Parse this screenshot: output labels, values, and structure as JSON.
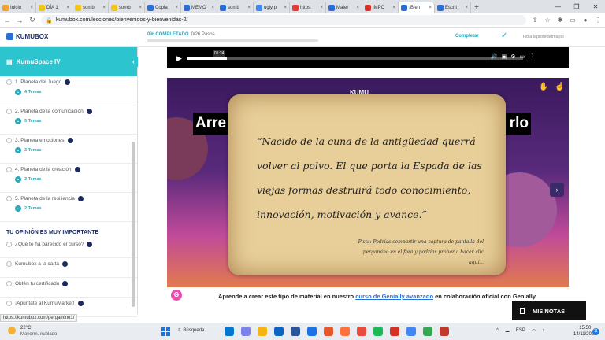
{
  "browser": {
    "tabs": [
      {
        "label": "Inicio",
        "color": "#f0a22b"
      },
      {
        "label": "DÍA 1",
        "color": "#f0c419"
      },
      {
        "label": "somb",
        "color": "#f0c419"
      },
      {
        "label": "somb",
        "color": "#f0c419"
      },
      {
        "label": "Copia",
        "color": "#2b6fd6"
      },
      {
        "label": "MEMO",
        "color": "#2b6fd6"
      },
      {
        "label": "somb",
        "color": "#2b6fd6"
      },
      {
        "label": "ugly p",
        "color": "#4285f4"
      },
      {
        "label": "https:",
        "color": "#e53935"
      },
      {
        "label": "Mater",
        "color": "#2b6fd6"
      },
      {
        "label": "IMPO",
        "color": "#d93025"
      },
      {
        "label": "¡Bien",
        "color": "#2b6fd6",
        "active": true
      },
      {
        "label": "Escrit",
        "color": "#2b6fd6"
      }
    ],
    "url": "kumubox.com/lecciones/bienvenidos-y-bienvenidas-2/",
    "status_url": "https://kumubox.com/pergamino1/"
  },
  "header": {
    "logo": "KUMUBOX",
    "progress_label": "0% COMPLETADO",
    "progress_steps": "0/26 Pasos",
    "progress_value": 0,
    "complete_label": "Completar",
    "greeting": "Hola laprofedelmapsi"
  },
  "sidebar": {
    "title": "KumuSpace IV",
    "items": [
      {
        "label": "1. Planeta del Juego",
        "sub": "4 Temas"
      },
      {
        "label": "2. Planeta de la comunicación",
        "sub": "3 Temas"
      },
      {
        "label": "3. Planeta emociones",
        "sub": "3 Temas"
      },
      {
        "label": "4. Planeta de la creación",
        "sub": "3 Temas"
      },
      {
        "label": "5. Planeta de la resiliencia",
        "sub": "2 Temas"
      }
    ],
    "section_title": "TU OPINIÓN ES MUY IMPORTANTE",
    "opinion_items": [
      {
        "label": "¿Qué te ha parecido el curso?"
      },
      {
        "label": "Kumubox a la carta"
      },
      {
        "label": "Obtén tu certificado"
      },
      {
        "label": "¡Apúntate al KumuMarket!"
      }
    ]
  },
  "video": {
    "time": "01:24",
    "progress": 0.12
  },
  "genially": {
    "kumu_tag": "KUMU",
    "banner_left": "Arre",
    "banner_right": "rlo",
    "quote": "“Nacido de la cuna de la antigüedad querrá volver al polvo. El que porta la Espada de las viejas formas destruirá todo conocimiento, innovación, motivación y avance.”",
    "tip": "Pista: Podrías compartir una captura de pantalla del pergamino en el foro y podrías probar a hacer clic aquí..."
  },
  "caption": {
    "g_logo": "G",
    "before": "Aprende a crear este tipo de material en nuestro ",
    "link": "curso de Genially avanzado",
    "after": " en colaboración oficial con Genially"
  },
  "notes_button": "MIS NOTAS",
  "taskbar": {
    "temp": "22°C",
    "weather": "Mayorm. nublado",
    "search": "Búsqueda",
    "lang": "ESP",
    "time": "15:50",
    "date": "14/11/2022",
    "notif_count": "11",
    "apps": [
      "#0078d4",
      "#7b83eb",
      "#f6b40e",
      "#0a66c2",
      "#2b579a",
      "#1a73e8",
      "#e8572a",
      "#ff7139",
      "#e94b3c",
      "#1db954",
      "#d93025",
      "#4285f4",
      "#34a853",
      "#c0392b"
    ]
  }
}
